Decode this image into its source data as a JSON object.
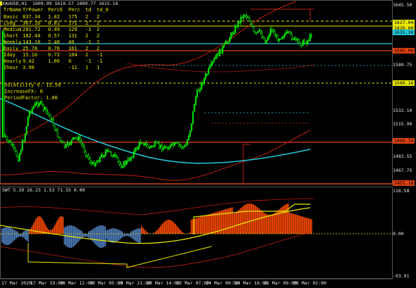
{
  "window": {
    "symbol_header": "XAUUSD,H1  1609.99 1619.57 1609.77 1615.16"
  },
  "table": {
    "headers": [
      "TrName",
      "TrPower",
      "PercE",
      "Perc",
      "td",
      "td_0"
    ],
    "rows": [
      {
        "name": "Basic",
        "power": "837.34",
        "perce": "1.02",
        "perc": "175",
        "td": "2",
        "td0": "2"
      },
      {
        "name": "Long",
        "power": "367.16",
        "perce": "0.81",
        "perc": "171",
        "td": "2",
        "td0": "2"
      },
      {
        "name": "Medium",
        "power": "201.72",
        "perce": "0.49",
        "perc": "129",
        "td": "-1",
        "td0": "2"
      },
      {
        "name": "Short",
        "power": "182.44",
        "perce": "0.57",
        "perc": "131",
        "td": "2",
        "td0": "2"
      },
      {
        "name": "Weekly",
        "power": "143.10",
        "perce": "2.48",
        "perc": "40",
        "td": "-1",
        "td0": "2"
      },
      {
        "name": "Daily",
        "power": "25.78",
        "perce": "0.76",
        "perc": "161",
        "td": "2",
        "td0": "2"
      },
      {
        "name": "Iday",
        "power": "15.10",
        "perce": "0.72",
        "perc": "104",
        "td": "2",
        "td0": "-1"
      },
      {
        "name": "Hourly",
        "power": "9.42",
        "perce": "1.06",
        "perc": "6",
        "td": "-1",
        "td0": "-1"
      },
      {
        "name": "Ihour",
        "power": "3.90",
        "perce": "",
        "perc": "-11",
        "td": "1",
        "td0": "1"
      }
    ]
  },
  "params": {
    "volatility": "Volatility V: 15.59",
    "increase": "IncreaseFX: 0",
    "period": "PeriodFactor: 1.00"
  },
  "price_axis": {
    "labels": [
      "1645.50",
      "1627.04",
      "1620.00",
      "1615.16",
      "1595.00",
      "1580.75",
      "1560.16",
      "1532.10",
      "1515.90",
      "1499.74",
      "1483.55",
      "1467.75",
      "1451.18"
    ]
  },
  "sub_window": {
    "title": "SWT 5.39 26.23 1.53 71.55 0.00",
    "labels": [
      "116.58",
      "0.00",
      "-93.91"
    ]
  },
  "time_axis": {
    "labels": [
      "17 Mar 2020",
      "17 Mar 19:00",
      "18 Mar 12:00",
      "19 Mar 05:00",
      "19 Mar 21:00",
      "20 Mar 14:00",
      "23 Mar 07:00",
      "24 Mar 00:00",
      "24 Mar 16:00",
      "25 Mar 09:00",
      "26 Mar 02:00"
    ]
  },
  "colors": {
    "candle": "#00ff00",
    "ma_cyan": "#20c8d8",
    "envelope_red": "#c02010",
    "table_text": "#e8e800",
    "hist_orange": "#ff4a00",
    "hist_blue": "#5080c0"
  }
}
